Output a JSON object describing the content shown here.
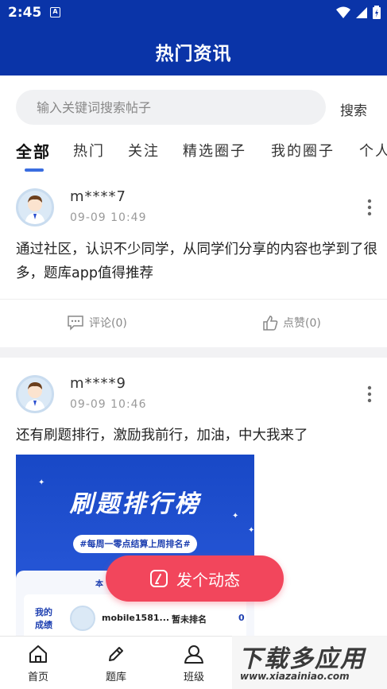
{
  "status_bar": {
    "time": "2:45",
    "notification_glyph": "A"
  },
  "header": {
    "title": "热门资讯"
  },
  "search": {
    "placeholder": "输入关键词搜索帖子",
    "button_label": "搜索"
  },
  "tabs": [
    {
      "label": "全部",
      "active": true
    },
    {
      "label": "热门",
      "active": false
    },
    {
      "label": "关注",
      "active": false
    },
    {
      "label": "精选圈子",
      "active": false
    },
    {
      "label": "我的圈子",
      "active": false
    },
    {
      "label": "个人",
      "active": false
    }
  ],
  "posts": [
    {
      "username": "m****7",
      "time": "09-09 10:49",
      "text": "通过社区，认识不少同学，从同学们分享的内容也学到了很多，题库app值得推荐",
      "comment_label": "评论(0)",
      "like_label": "点赞(0)"
    },
    {
      "username": "m****9",
      "time": "09-09 10:46",
      "text": "还有刷题排行，激励我前行，加油，中大我来了",
      "image": {
        "title": "刷题排行榜",
        "pill": "#每周一零点结算上周排名#",
        "tab_partial": "本",
        "mine_label_1": "我的",
        "mine_label_2": "成绩",
        "user": "mobile1581...",
        "rank": "暂未排名",
        "score": "0"
      }
    }
  ],
  "fab": {
    "label": "发个动态"
  },
  "bottom_nav": [
    {
      "label": "首页",
      "icon": "home-icon"
    },
    {
      "label": "题库",
      "icon": "pencil-icon"
    },
    {
      "label": "班级",
      "icon": "class-icon"
    }
  ],
  "watermark": {
    "text": "下载多应用",
    "url": "www.xiazainiao.com"
  },
  "colors": {
    "primary": "#0a34a8",
    "accent": "#3a6de0",
    "fab": "#f2465c"
  }
}
